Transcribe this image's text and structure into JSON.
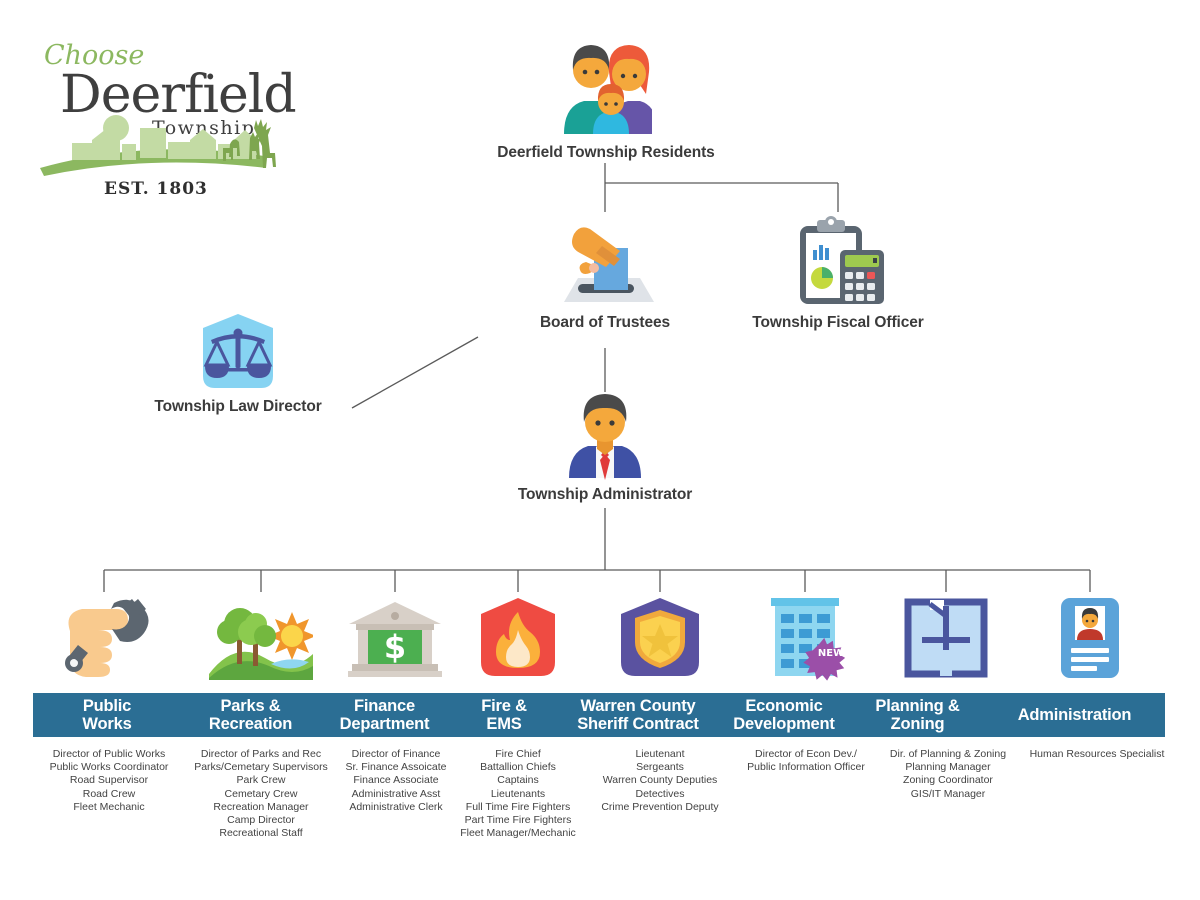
{
  "logo": {
    "script_word": "Choose",
    "main_word": "Deerfield",
    "sub_word": "Township",
    "established": "EST.  1803",
    "colors": {
      "green": "#8cb860",
      "dark": "#3f3f3f",
      "pale_green": "#c3dba4"
    }
  },
  "theme": {
    "band_color": "#2b6e94",
    "line_color": "#5a5a5a",
    "label_color": "#3b3b3b",
    "role_color": "#434343"
  },
  "top_nodes": [
    {
      "id": "residents",
      "label": "Deerfield Township Residents",
      "icon": "family-icon"
    },
    {
      "id": "trustees",
      "label": "Board of Trustees",
      "icon": "ballot-box-icon"
    },
    {
      "id": "fiscal_officer",
      "label": "Township Fiscal Officer",
      "icon": "clipboard-calculator-icon"
    },
    {
      "id": "law_director",
      "label": "Township Law Director",
      "icon": "scales-of-justice-icon"
    },
    {
      "id": "administrator",
      "label": "Township Administrator",
      "icon": "businessman-icon"
    }
  ],
  "departments": [
    {
      "id": "public-works",
      "title_lines": [
        "Public",
        "Works"
      ],
      "icon": "hand-wrench-icon",
      "roles": [
        "Director of Public Works",
        "Public Works Coordinator",
        "Road Supervisor",
        "Road Crew",
        "Fleet Mechanic"
      ]
    },
    {
      "id": "parks-recreation",
      "title_lines": [
        "Parks &",
        "Recreation"
      ],
      "icon": "park-landscape-icon",
      "roles": [
        "Director of Parks and Rec",
        "Parks/Cemetary Supervisors",
        "Park Crew",
        "Cemetary Crew",
        "Recreation Manager",
        "Camp Director",
        "Recreational Staff"
      ]
    },
    {
      "id": "finance-department",
      "title_lines": [
        "Finance",
        "Department"
      ],
      "icon": "bank-dollar-icon",
      "roles": [
        "Director of Finance",
        "Sr. Finance Assoicate",
        "Finance Associate",
        "Administrative Asst",
        "Administrative Clerk"
      ]
    },
    {
      "id": "fire-ems",
      "title_lines": [
        "Fire &",
        "EMS"
      ],
      "icon": "flame-shield-icon",
      "roles": [
        "Fire Chief",
        "Battallion Chiefs",
        "Captains",
        "Lieutenants",
        "Full Time Fire Fighters",
        "Part Time Fire Fighters",
        "Fleet Manager/Mechanic"
      ]
    },
    {
      "id": "warren-county-sheriff-contract",
      "title_lines": [
        "Warren County",
        "Sheriff Contract"
      ],
      "icon": "police-badge-icon",
      "roles": [
        "Lieutenant",
        "Sergeants",
        "Warren County Deputies",
        "Detectives",
        "Crime Prevention Deputy"
      ]
    },
    {
      "id": "economic-development",
      "title_lines": [
        "Economic",
        "Development"
      ],
      "icon": "office-building-new-icon",
      "badge": "NEW",
      "roles": [
        "Director of Econ Dev./",
        "Public Information Officer"
      ]
    },
    {
      "id": "planning-zoning",
      "title_lines": [
        "Planning &",
        "Zoning"
      ],
      "icon": "floor-plan-icon",
      "roles": [
        "Dir. of Planning & Zoning",
        "Planning Manager",
        "Zoning Coordinator",
        "GIS/IT Manager"
      ]
    },
    {
      "id": "administration",
      "title_lines": [
        "Administration"
      ],
      "icon": "id-badge-icon",
      "roles": [
        "Human Resources Specialist"
      ]
    }
  ]
}
